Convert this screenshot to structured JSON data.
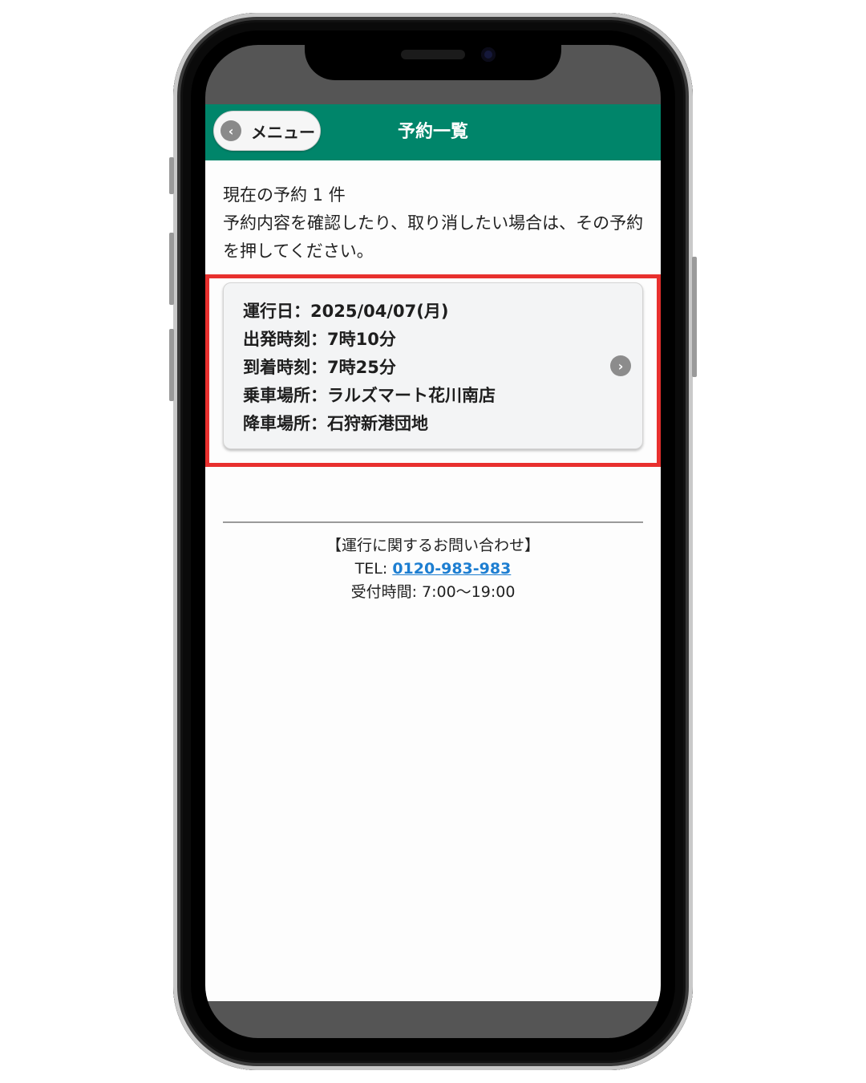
{
  "header": {
    "back_label": "メニュー",
    "title": "予約一覧"
  },
  "intro": {
    "count_text": "現在の予約 1 件",
    "instruction": "予約内容を確認したり、取り消したい場合は、その予約を押してください。"
  },
  "reservation": {
    "date_line": "運行日：2025/04/07(月)",
    "departure_line": "出発時刻：7時10分",
    "arrival_line": "到着時刻：7時25分",
    "boarding_line": "乗車場所：ラルズマート花川南店",
    "alighting_line": "降車場所：石狩新港団地",
    "highlight_color": "#e8302e"
  },
  "contact": {
    "heading": "【運行に関するお問い合わせ】",
    "tel_prefix": "TEL: ",
    "tel_number": "0120-983-983",
    "hours": "受付時間: 7:00〜19:00"
  },
  "colors": {
    "header_bg": "#00856a",
    "link": "#1d7ed1"
  }
}
